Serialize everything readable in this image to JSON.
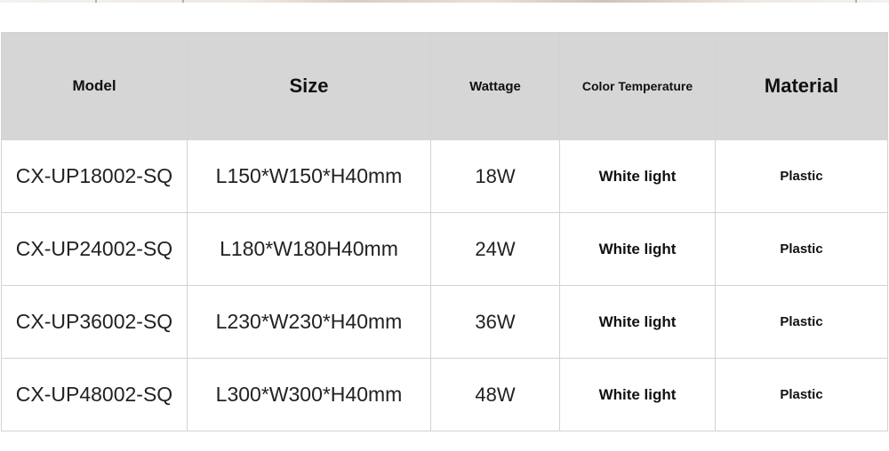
{
  "table": {
    "headers": {
      "model": "Model",
      "size": "Size",
      "wattage": "Wattage",
      "color_temperature": "Color Temperature",
      "material": "Material"
    },
    "rows": [
      {
        "model": "CX-UP18002-SQ",
        "size": "L150*W150*H40mm",
        "wattage": "18W",
        "color_temperature": "White light",
        "material": "Plastic"
      },
      {
        "model": "CX-UP24002-SQ",
        "size": "L180*W180H40mm",
        "wattage": "24W",
        "color_temperature": "White light",
        "material": "Plastic"
      },
      {
        "model": "CX-UP36002-SQ",
        "size": "L230*W230*H40mm",
        "wattage": "36W",
        "color_temperature": "White light",
        "material": "Plastic"
      },
      {
        "model": "CX-UP48002-SQ",
        "size": "L300*W300*H40mm",
        "wattage": "48W",
        "color_temperature": "White light",
        "material": "Plastic"
      }
    ]
  },
  "colors": {
    "header_bg": "#d6d6d6",
    "border": "#d3d3d3",
    "text": "#1a1a1a"
  }
}
